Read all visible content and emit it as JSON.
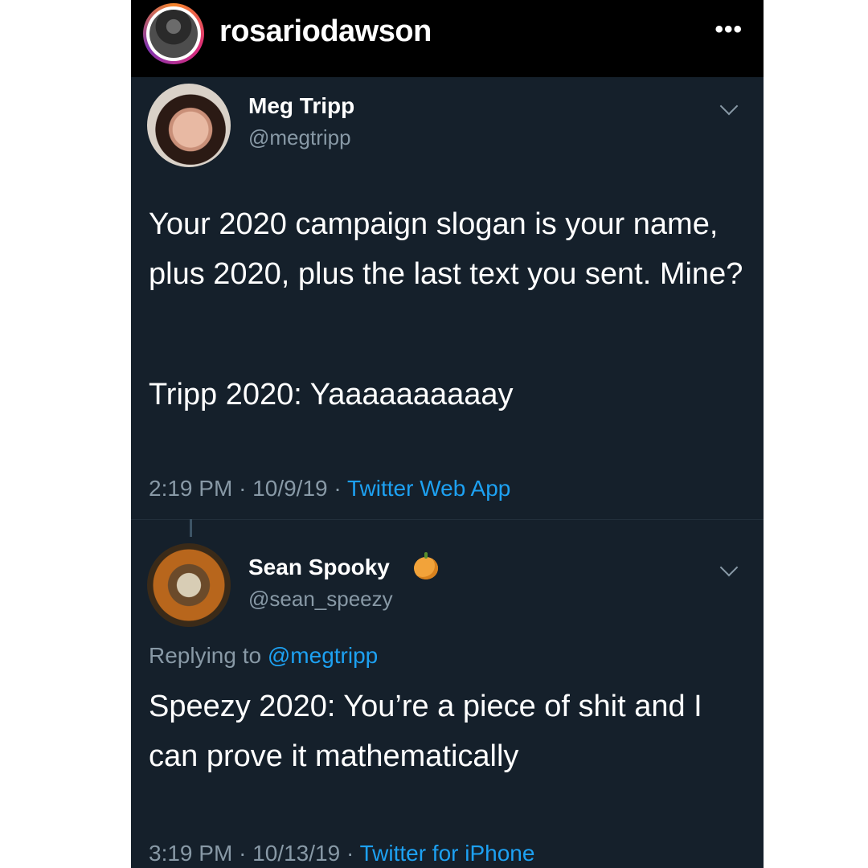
{
  "instagram": {
    "username": "rosariodawson",
    "more_icon": "•••"
  },
  "tweets": [
    {
      "display_name": "Meg Tripp",
      "handle": "@megtripp",
      "text_lines": [
        "Your 2020 campaign slogan is your name, plus 2020, plus the last text you sent. Mine?",
        "Tripp 2020: Yaaaaaaaaaay"
      ],
      "time": "2:19 PM",
      "date": "10/9/19",
      "source": "Twitter Web App"
    },
    {
      "display_name": "Sean Spooky",
      "name_emoji": "jack-o-lantern-icon",
      "handle": "@sean_speezy",
      "replying_label": "Replying to",
      "replying_to": "@megtripp",
      "text": "Speezy 2020: You’re a piece of shit and I can prove it mathematically",
      "time": "3:19 PM",
      "date": "10/13/19",
      "source": "Twitter for iPhone"
    }
  ],
  "colors": {
    "background": "#15202b",
    "text": "#ffffff",
    "muted": "#8899a6",
    "link": "#1da1f2",
    "header": "#000000"
  },
  "separator": "·"
}
